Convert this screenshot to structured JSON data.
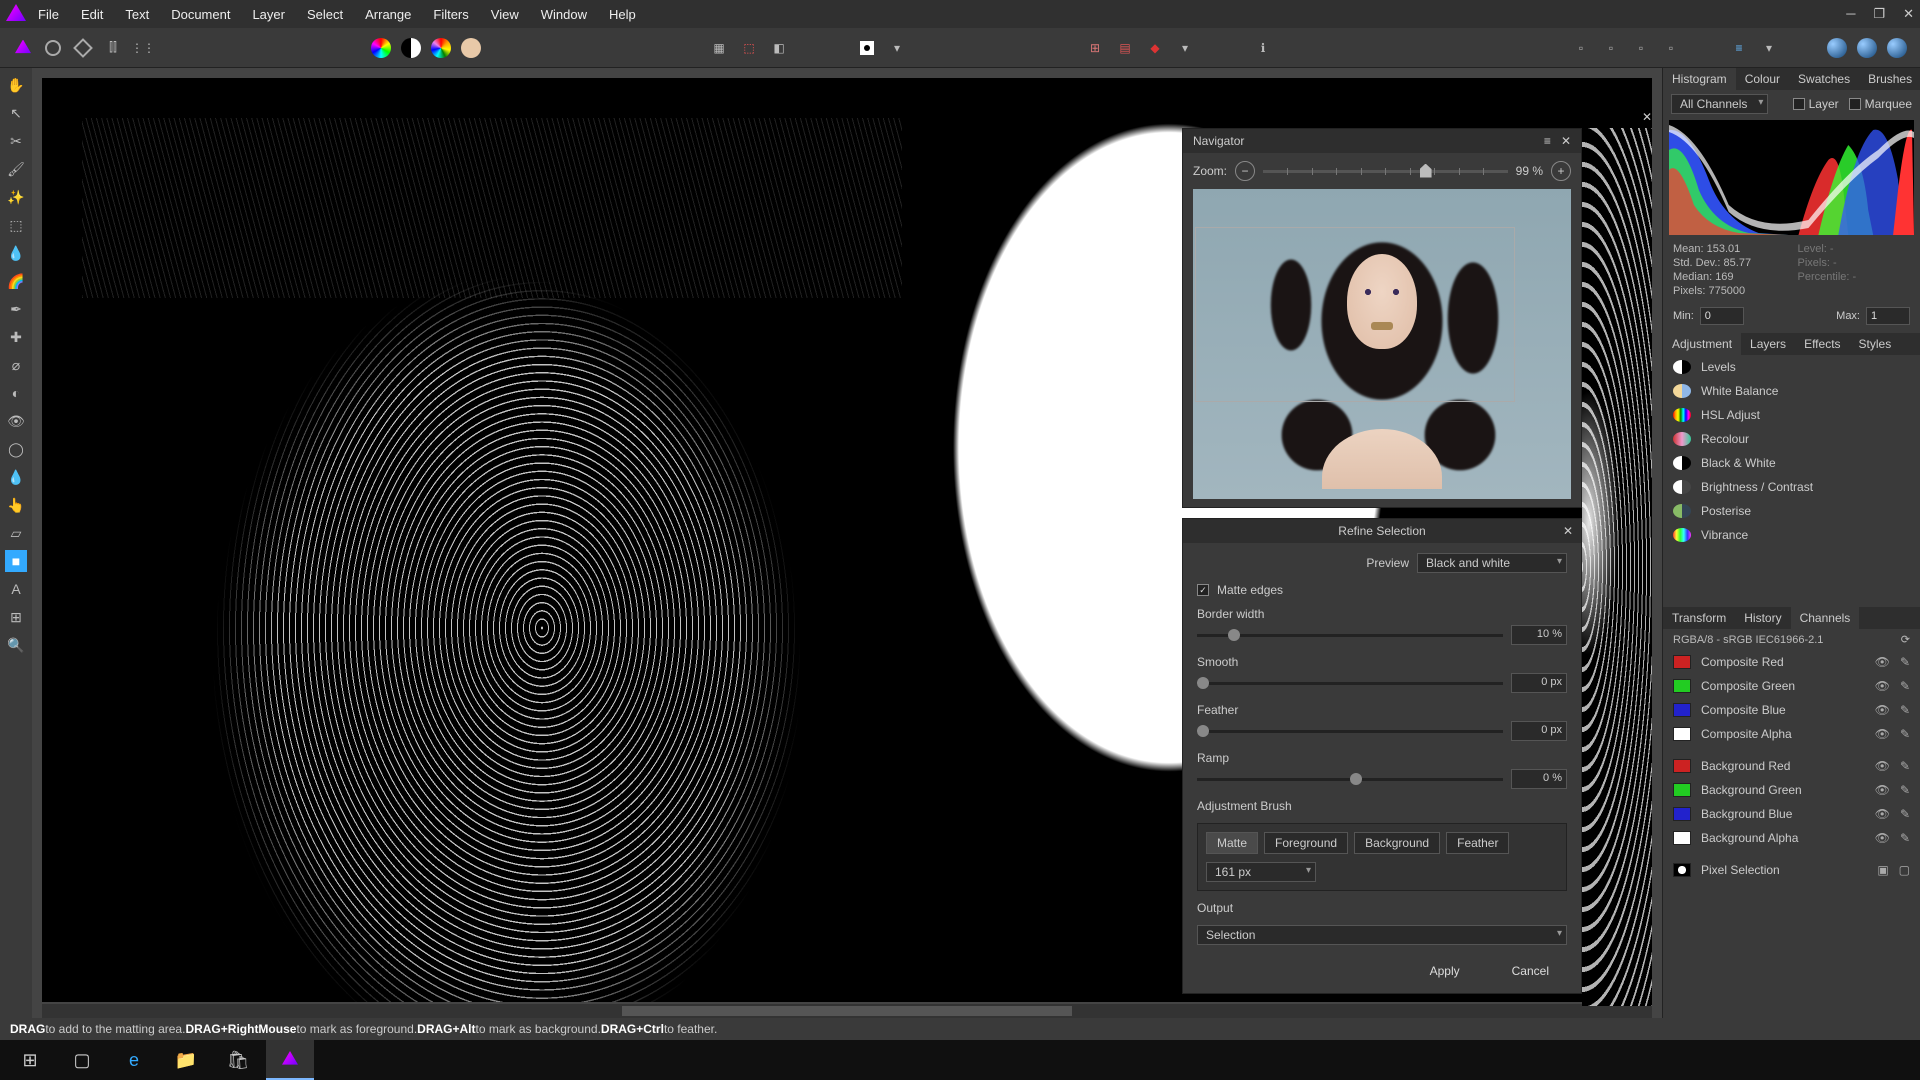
{
  "menu": [
    "File",
    "Edit",
    "Text",
    "Document",
    "Layer",
    "Select",
    "Arrange",
    "Filters",
    "View",
    "Window",
    "Help"
  ],
  "navigator": {
    "title": "Navigator",
    "zoom_label": "Zoom:",
    "zoom_value": "99 %"
  },
  "refine": {
    "title": "Refine Selection",
    "preview_label": "Preview",
    "preview_value": "Black and white",
    "matte_edges": "Matte edges",
    "border_width_label": "Border width",
    "border_width_value": "10 %",
    "smooth_label": "Smooth",
    "smooth_value": "0 px",
    "feather_label": "Feather",
    "feather_value": "0 px",
    "ramp_label": "Ramp",
    "ramp_value": "0 %",
    "adj_brush": "Adjustment Brush",
    "brush_modes": [
      "Matte",
      "Foreground",
      "Background",
      "Feather"
    ],
    "brush_width": "161 px",
    "output_label": "Output",
    "output_value": "Selection",
    "apply": "Apply",
    "cancel": "Cancel"
  },
  "hist_tabs": [
    "Histogram",
    "Colour",
    "Swatches",
    "Brushes"
  ],
  "hist_channel": "All Channels",
  "hist_layer": "Layer",
  "hist_marquee": "Marquee",
  "stats": {
    "mean": "Mean: 153.01",
    "stddev": "Std. Dev.: 85.77",
    "median": "Median: 169",
    "pixels": "Pixels: 775000",
    "level": "Level: -",
    "pixels2": "Pixels: -",
    "percentile": "Percentile: -",
    "min_label": "Min:",
    "min_val": "0",
    "max_label": "Max:",
    "max_val": "1"
  },
  "tabs2": [
    "Adjustment",
    "Layers",
    "Effects",
    "Styles"
  ],
  "adjustments": [
    {
      "name": "Levels",
      "c1": "#fff",
      "c2": "#000"
    },
    {
      "name": "White Balance",
      "c1": "#f3d89a",
      "c2": "#8fb7e8"
    },
    {
      "name": "HSL Adjust",
      "c1": "linear-gradient(90deg,red,orange,yellow,green,cyan,blue,magenta,red)",
      "c2": ""
    },
    {
      "name": "Recolour",
      "c1": "linear-gradient(90deg,#c33,#e9c,#3c9)",
      "c2": ""
    },
    {
      "name": "Black & White",
      "c1": "#fff",
      "c2": "#000"
    },
    {
      "name": "Brightness / Contrast",
      "c1": "#fff",
      "c2": "#444"
    },
    {
      "name": "Posterise",
      "c1": "#8b6",
      "c2": "#345"
    },
    {
      "name": "Vibrance",
      "c1": "linear-gradient(90deg,#f33,#ff3,#3f3,#3ff,#33f,#f3f)",
      "c2": ""
    }
  ],
  "tabs3": [
    "Transform",
    "History",
    "Channels"
  ],
  "colorspace": "RGBA/8 - sRGB IEC61966-2.1",
  "channels": [
    {
      "name": "Composite Red",
      "color": "#c22"
    },
    {
      "name": "Composite Green",
      "color": "#2c2"
    },
    {
      "name": "Composite Blue",
      "color": "#22c"
    },
    {
      "name": "Composite Alpha",
      "color": "#fff"
    },
    {
      "name": "Background Red",
      "color": "#c22"
    },
    {
      "name": "Background Green",
      "color": "#2c2"
    },
    {
      "name": "Background Blue",
      "color": "#22c"
    },
    {
      "name": "Background Alpha",
      "color": "#fff"
    },
    {
      "name": "Pixel Selection",
      "color": "radial"
    }
  ],
  "status": {
    "s1": "DRAG",
    "t1": " to add to the matting area. ",
    "s2": "DRAG+RightMouse",
    "t2": " to mark as foreground. ",
    "s3": "DRAG+Alt",
    "t3": " to mark as background. ",
    "s4": "DRAG+Ctrl",
    "t4": " to feather."
  }
}
